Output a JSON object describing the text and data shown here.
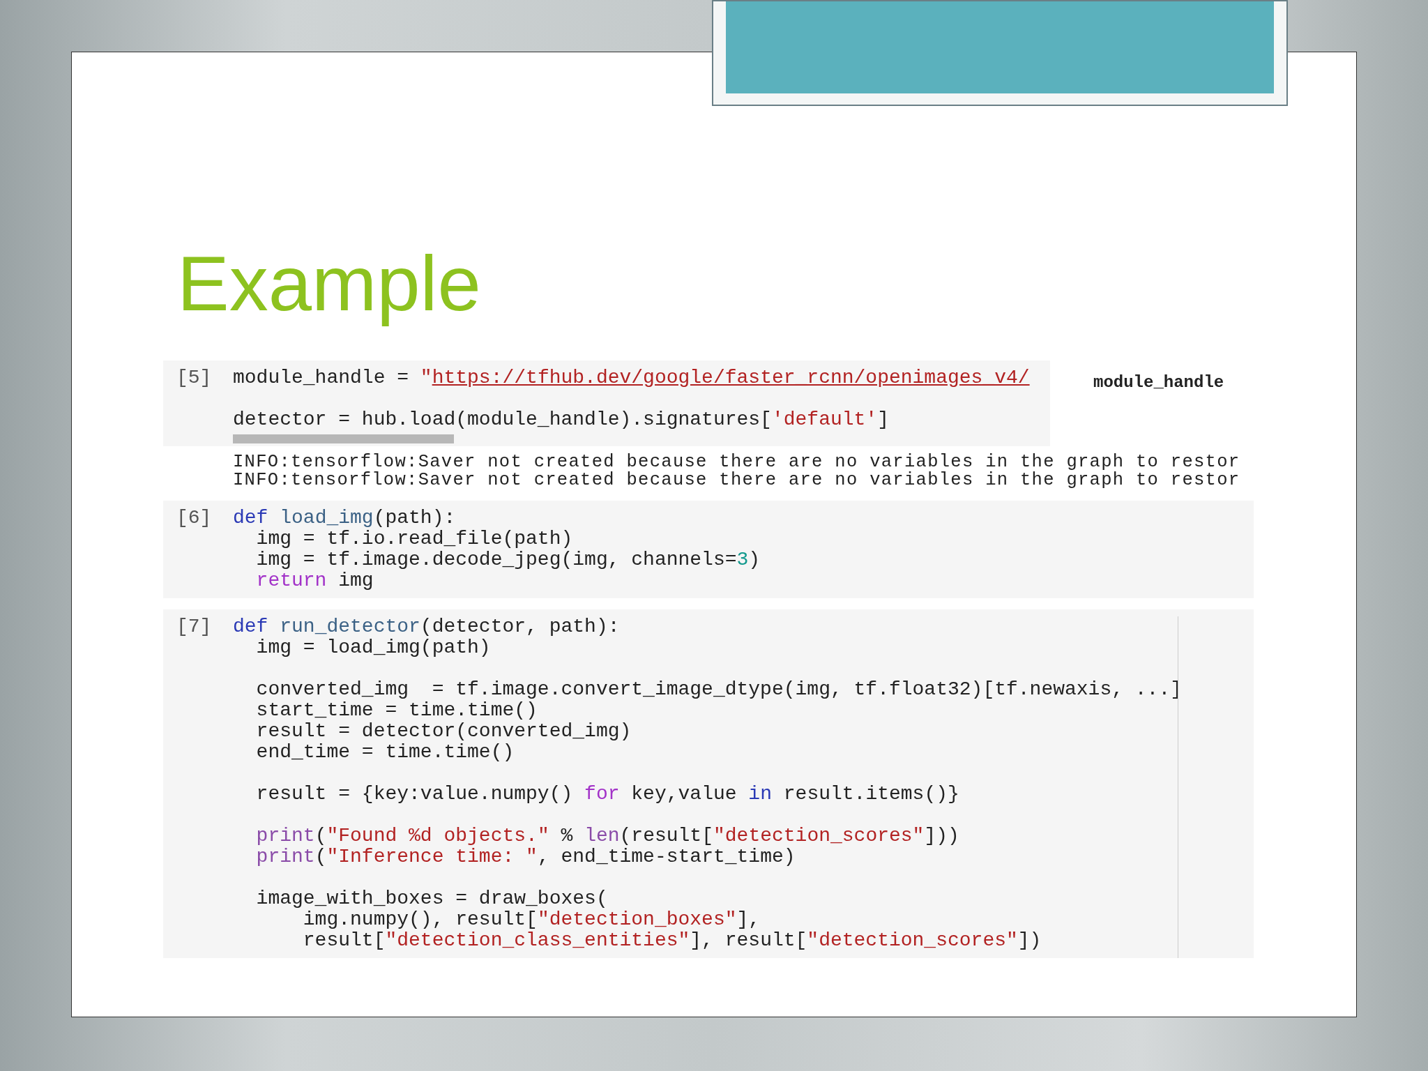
{
  "slide": {
    "title": "Example"
  },
  "cells": [
    {
      "prompt": "[5]",
      "scrollbar": true,
      "side_output": "module_handle",
      "lines": [
        {
          "tokens": [
            {
              "text": "module_handle = ",
              "kind": "plain"
            },
            {
              "text": "\"",
              "kind": "string"
            },
            {
              "text": "https://tfhub.dev/google/faster_rcnn/openimages_v4/",
              "kind": "link"
            }
          ]
        },
        {
          "gap_before": true,
          "tokens": [
            {
              "text": "detector = hub.load(module_handle).signatures[",
              "kind": "plain"
            },
            {
              "text": "'default'",
              "kind": "string"
            },
            {
              "text": "]",
              "kind": "plain"
            }
          ]
        }
      ],
      "outputs": [
        "INFO:tensorflow:Saver not created because there are no variables in the graph to restor",
        "INFO:tensorflow:Saver not created because there are no variables in the graph to restor"
      ]
    },
    {
      "prompt": "[6]",
      "lines": [
        {
          "tokens": [
            {
              "text": "def ",
              "kind": "keyword"
            },
            {
              "text": "load_img",
              "kind": "function"
            },
            {
              "text": "(path):",
              "kind": "plain"
            }
          ]
        },
        {
          "tokens": [
            {
              "text": "  img = tf.io.read_file(path)",
              "kind": "plain"
            }
          ]
        },
        {
          "tokens": [
            {
              "text": "  img = tf.image.decode_jpeg(img, channels=",
              "kind": "plain"
            },
            {
              "text": "3",
              "kind": "number"
            },
            {
              "text": ")",
              "kind": "plain"
            }
          ]
        },
        {
          "tokens": [
            {
              "text": "  return",
              "kind": "control"
            },
            {
              "text": " img",
              "kind": "plain"
            }
          ]
        }
      ]
    },
    {
      "prompt": "[7]",
      "ruler": true,
      "lines": [
        {
          "tokens": [
            {
              "text": "def ",
              "kind": "keyword"
            },
            {
              "text": "run_detector",
              "kind": "function"
            },
            {
              "text": "(detector, path):",
              "kind": "plain"
            }
          ]
        },
        {
          "tokens": [
            {
              "text": "  img = load_img(path)",
              "kind": "plain"
            }
          ]
        },
        {
          "gap_before": true,
          "tokens": [
            {
              "text": "  converted_img  = tf.image.convert_image_dtype(img, tf.float32)[tf.newaxis, ...]",
              "kind": "plain"
            }
          ]
        },
        {
          "tokens": [
            {
              "text": "  start_time = time.time()",
              "kind": "plain"
            }
          ]
        },
        {
          "tokens": [
            {
              "text": "  result = detector(converted_img)",
              "kind": "plain"
            }
          ]
        },
        {
          "tokens": [
            {
              "text": "  end_time = time.time()",
              "kind": "plain"
            }
          ]
        },
        {
          "gap_before": true,
          "tokens": [
            {
              "text": "  result = {key:value.numpy() ",
              "kind": "plain"
            },
            {
              "text": "for",
              "kind": "control"
            },
            {
              "text": " key,value ",
              "kind": "plain"
            },
            {
              "text": "in",
              "kind": "keyword"
            },
            {
              "text": " result.items()}",
              "kind": "plain"
            }
          ]
        },
        {
          "gap_before": true,
          "tokens": [
            {
              "text": "  print",
              "kind": "builtin"
            },
            {
              "text": "(",
              "kind": "plain"
            },
            {
              "text": "\"Found %d objects.\"",
              "kind": "string"
            },
            {
              "text": " % ",
              "kind": "plain"
            },
            {
              "text": "len",
              "kind": "builtin"
            },
            {
              "text": "(result[",
              "kind": "plain"
            },
            {
              "text": "\"detection_scores\"",
              "kind": "string"
            },
            {
              "text": "]))",
              "kind": "plain"
            }
          ]
        },
        {
          "tokens": [
            {
              "text": "  print",
              "kind": "builtin"
            },
            {
              "text": "(",
              "kind": "plain"
            },
            {
              "text": "\"Inference time: \"",
              "kind": "string"
            },
            {
              "text": ", end_time-start_time)",
              "kind": "plain"
            }
          ]
        },
        {
          "gap_before": true,
          "tokens": [
            {
              "text": "  image_with_boxes = draw_boxes(",
              "kind": "plain"
            }
          ]
        },
        {
          "tokens": [
            {
              "text": "      img.numpy(), result[",
              "kind": "plain"
            },
            {
              "text": "\"detection_boxes\"",
              "kind": "string"
            },
            {
              "text": "],",
              "kind": "plain"
            }
          ]
        },
        {
          "tokens": [
            {
              "text": "      result[",
              "kind": "plain"
            },
            {
              "text": "\"detection_class_entities\"",
              "kind": "string"
            },
            {
              "text": "], result[",
              "kind": "plain"
            },
            {
              "text": "\"detection_scores\"",
              "kind": "string"
            },
            {
              "text": "])",
              "kind": "plain"
            }
          ]
        }
      ]
    }
  ]
}
